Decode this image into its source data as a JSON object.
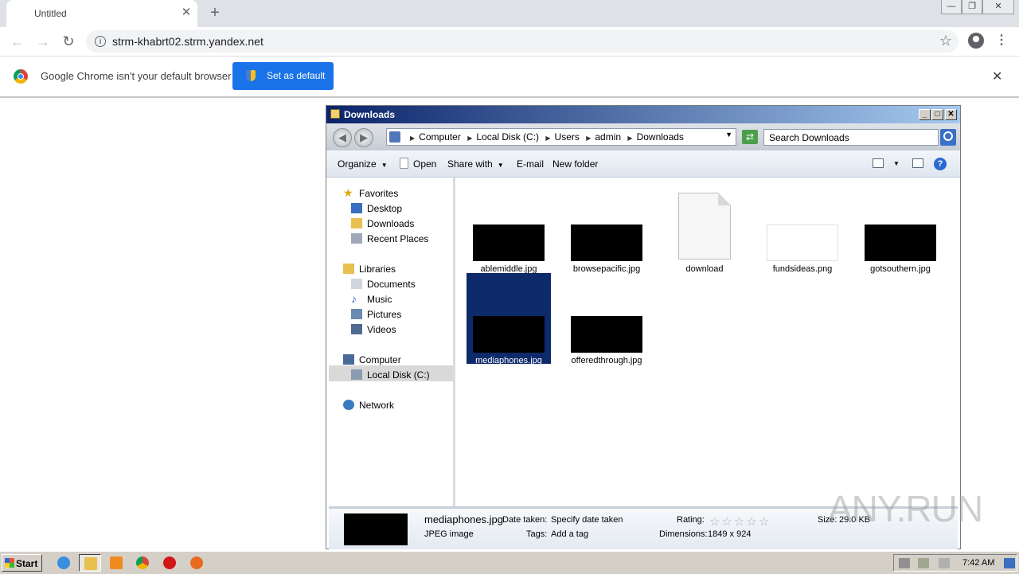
{
  "browser": {
    "tab_title": "Untitled",
    "url": "strm-khabrt02.strm.yandex.net",
    "infobar_message": "Google Chrome isn't your default browser",
    "set_default_label": "Set as default"
  },
  "explorer": {
    "title": "Downloads",
    "breadcrumbs": [
      "Computer",
      "Local Disk (C:)",
      "Users",
      "admin",
      "Downloads"
    ],
    "search_placeholder": "Search Downloads",
    "toolbar": {
      "organize": "Organize",
      "open": "Open",
      "share_with": "Share with",
      "email": "E-mail",
      "new_folder": "New folder"
    },
    "nav": {
      "favorites": "Favorites",
      "desktop": "Desktop",
      "downloads": "Downloads",
      "recent_places": "Recent Places",
      "libraries": "Libraries",
      "documents": "Documents",
      "music": "Music",
      "pictures": "Pictures",
      "videos": "Videos",
      "computer": "Computer",
      "local_disk": "Local Disk (C:)",
      "network": "Network"
    },
    "files": [
      "ablemiddle.jpg",
      "browsepacific.jpg",
      "download",
      "fundsideas.png",
      "gotsouthern.jpg",
      "mediaphones.jpg",
      "offeredthrough.jpg"
    ],
    "selected_file": "mediaphones.jpg",
    "details": {
      "name": "mediaphones.jpg",
      "type": "JPEG image",
      "date_taken_label": "Date taken:",
      "date_taken_value": "Specify date taken",
      "tags_label": "Tags:",
      "tags_value": "Add a tag",
      "rating_label": "Rating:",
      "dimensions_label": "Dimensions:",
      "dimensions_value": "1849 x 924",
      "size_label": "Size:",
      "size_value": "29.0 KB"
    }
  },
  "watermark": "ANY.RUN",
  "taskbar": {
    "start_label": "Start",
    "clock": "7:42 AM"
  }
}
